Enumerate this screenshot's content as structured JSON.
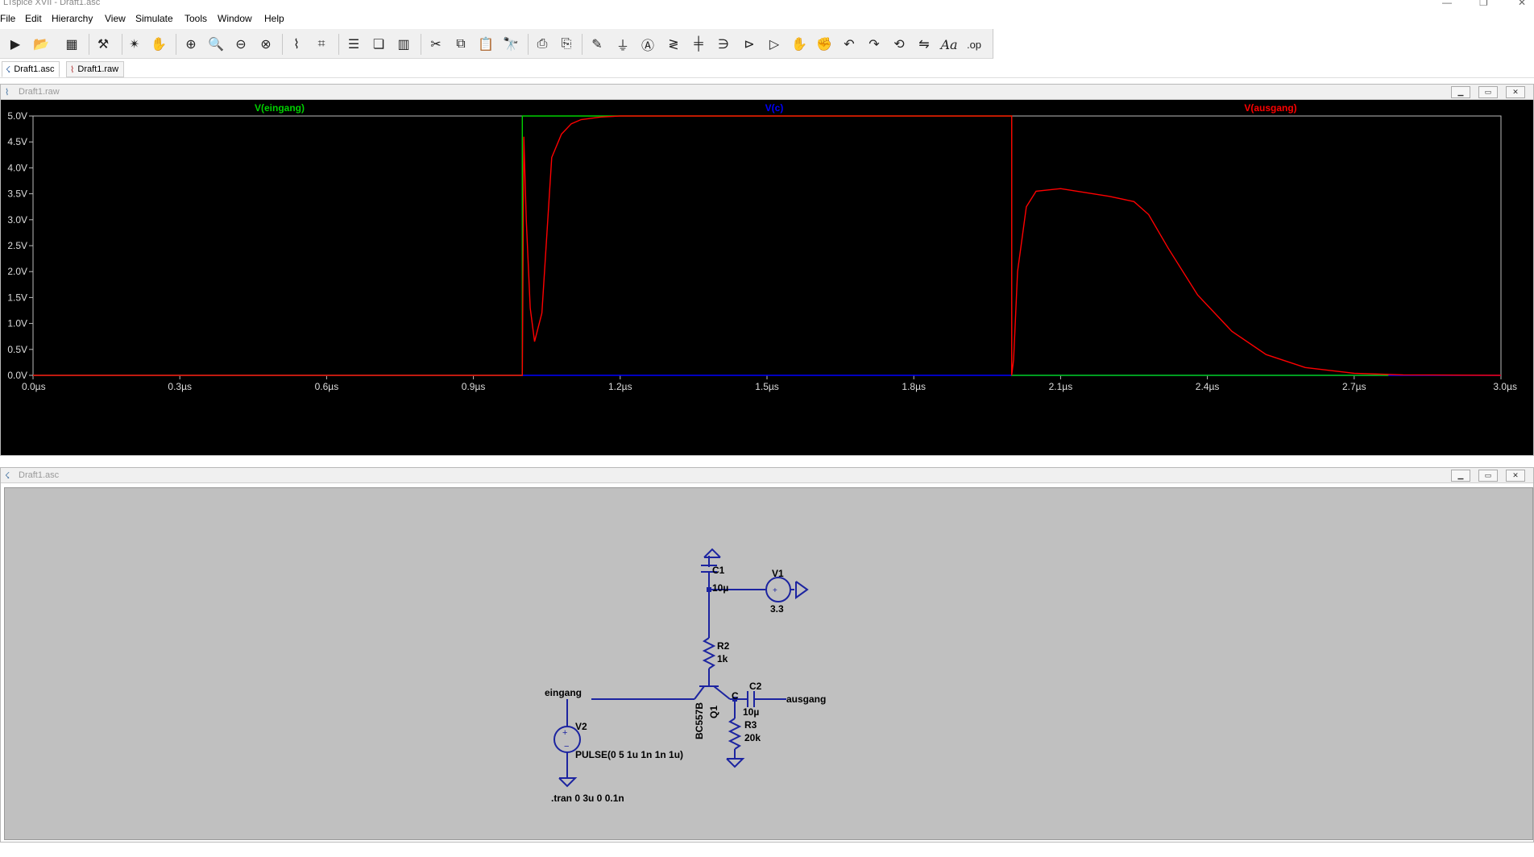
{
  "app": {
    "title": "LTspice XVII - Draft1.asc",
    "min_icon": "minimize-icon",
    "max_icon": "restore-icon",
    "close_icon": "close-icon"
  },
  "menu": [
    {
      "label": "File"
    },
    {
      "label": "Edit"
    },
    {
      "label": "Hierarchy"
    },
    {
      "label": "View"
    },
    {
      "label": "Simulate"
    },
    {
      "label": "Tools"
    },
    {
      "label": "Window"
    },
    {
      "label": "Help"
    }
  ],
  "toolbar": {
    "icons": [
      "run-icon",
      "open-icon",
      "save-icon",
      "control-panel-icon",
      "run-simulation-icon",
      "pan-icon",
      "zoom-in-icon",
      "zoom-area-icon",
      "zoom-out-icon",
      "zoom-fit-icon",
      "waveform-icon",
      "autorange-icon",
      "tile-horizontal-icon",
      "cascade-icon",
      "tile-vertical-icon",
      "cut-icon",
      "copy-icon",
      "paste-icon",
      "find-icon",
      "print-icon",
      "print-preview-icon",
      "wire-icon",
      "ground-icon",
      "label-icon",
      "resistor-icon",
      "capacitor-icon",
      "inductor-icon",
      "diode-icon",
      "component-icon",
      "move-icon",
      "drag-icon",
      "undo-icon",
      "redo-icon",
      "rotate-icon",
      "mirror-icon",
      "text-icon",
      "spice-directive-icon"
    ]
  },
  "tabs": [
    {
      "label": "Draft1.asc",
      "icon": "schematic-icon",
      "active": true
    },
    {
      "label": "Draft1.raw",
      "icon": "waveform-icon",
      "active": false
    }
  ],
  "plot_window": {
    "title": "Draft1.raw",
    "icon": "waveform-icon",
    "traces": [
      {
        "label": "V(eingang)",
        "color": "#00d000"
      },
      {
        "label": "V(c)",
        "color": "#0000ff"
      },
      {
        "label": "V(ausgang)",
        "color": "#ff0000"
      }
    ]
  },
  "schematic_window": {
    "title": "Draft1.asc",
    "icon": "schematic-icon",
    "labels": {
      "C1": "C1",
      "C1_val": "10µ",
      "V1": "V1",
      "V1_val": "3.3",
      "R2": "R2",
      "R2_val": "1k",
      "C2": "C2",
      "C2_val": "10µ",
      "R3": "R3",
      "R3_val": "20k",
      "Q1": "Q1",
      "Q1_model": "BC557B",
      "V2": "V2",
      "V2_val": "PULSE(0 5 1u 1n 1n 1u)",
      "net_in": "eingang",
      "net_out": "ausgang",
      "net_c": "C",
      "directive": ".tran 0 3u 0 0.1n"
    }
  },
  "chart_data": {
    "type": "line",
    "title": "",
    "xlabel": "",
    "ylabel": "",
    "xlim": [
      0,
      3.0
    ],
    "ylim": [
      0,
      5.0
    ],
    "x_unit": "µs",
    "y_unit": "V",
    "xticks": [
      "0.0µs",
      "0.3µs",
      "0.6µs",
      "0.9µs",
      "1.2µs",
      "1.5µs",
      "1.8µs",
      "2.1µs",
      "2.4µs",
      "2.7µs",
      "3.0µs"
    ],
    "yticks": [
      "0.0V",
      "0.5V",
      "1.0V",
      "1.5V",
      "2.0V",
      "2.5V",
      "3.0V",
      "3.5V",
      "4.0V",
      "4.5V",
      "5.0V"
    ],
    "grid": false,
    "legend": "top",
    "series": [
      {
        "name": "V(eingang)",
        "color": "#00d000",
        "x": [
          0,
          1.0,
          1.0,
          2.0,
          2.0,
          2.77
        ],
        "y": [
          0,
          0,
          5.0,
          5.0,
          0,
          0
        ]
      },
      {
        "name": "V(c)",
        "color": "#0000ff",
        "x": [
          0,
          3.0
        ],
        "y": [
          0,
          0
        ]
      },
      {
        "name": "V(ausgang)",
        "color": "#ff0000",
        "x": [
          0,
          1.0,
          1.003,
          1.008,
          1.016,
          1.025,
          1.04,
          1.06,
          1.08,
          1.1,
          1.12,
          1.16,
          1.2,
          1.3,
          1.6,
          1.9,
          2.0,
          2.0,
          2.004,
          2.012,
          2.03,
          2.05,
          2.1,
          2.2,
          2.25,
          2.28,
          2.32,
          2.38,
          2.45,
          2.52,
          2.6,
          2.7,
          2.8,
          3.0
        ],
        "y": [
          0,
          0,
          4.6,
          3.0,
          1.3,
          0.65,
          1.2,
          4.2,
          4.65,
          4.85,
          4.93,
          4.98,
          5.0,
          5.0,
          5.0,
          5.0,
          5.0,
          0,
          0.3,
          2.0,
          3.25,
          3.55,
          3.6,
          3.45,
          3.35,
          3.1,
          2.45,
          1.55,
          0.85,
          0.4,
          0.15,
          0.04,
          0.01,
          0
        ]
      }
    ]
  }
}
